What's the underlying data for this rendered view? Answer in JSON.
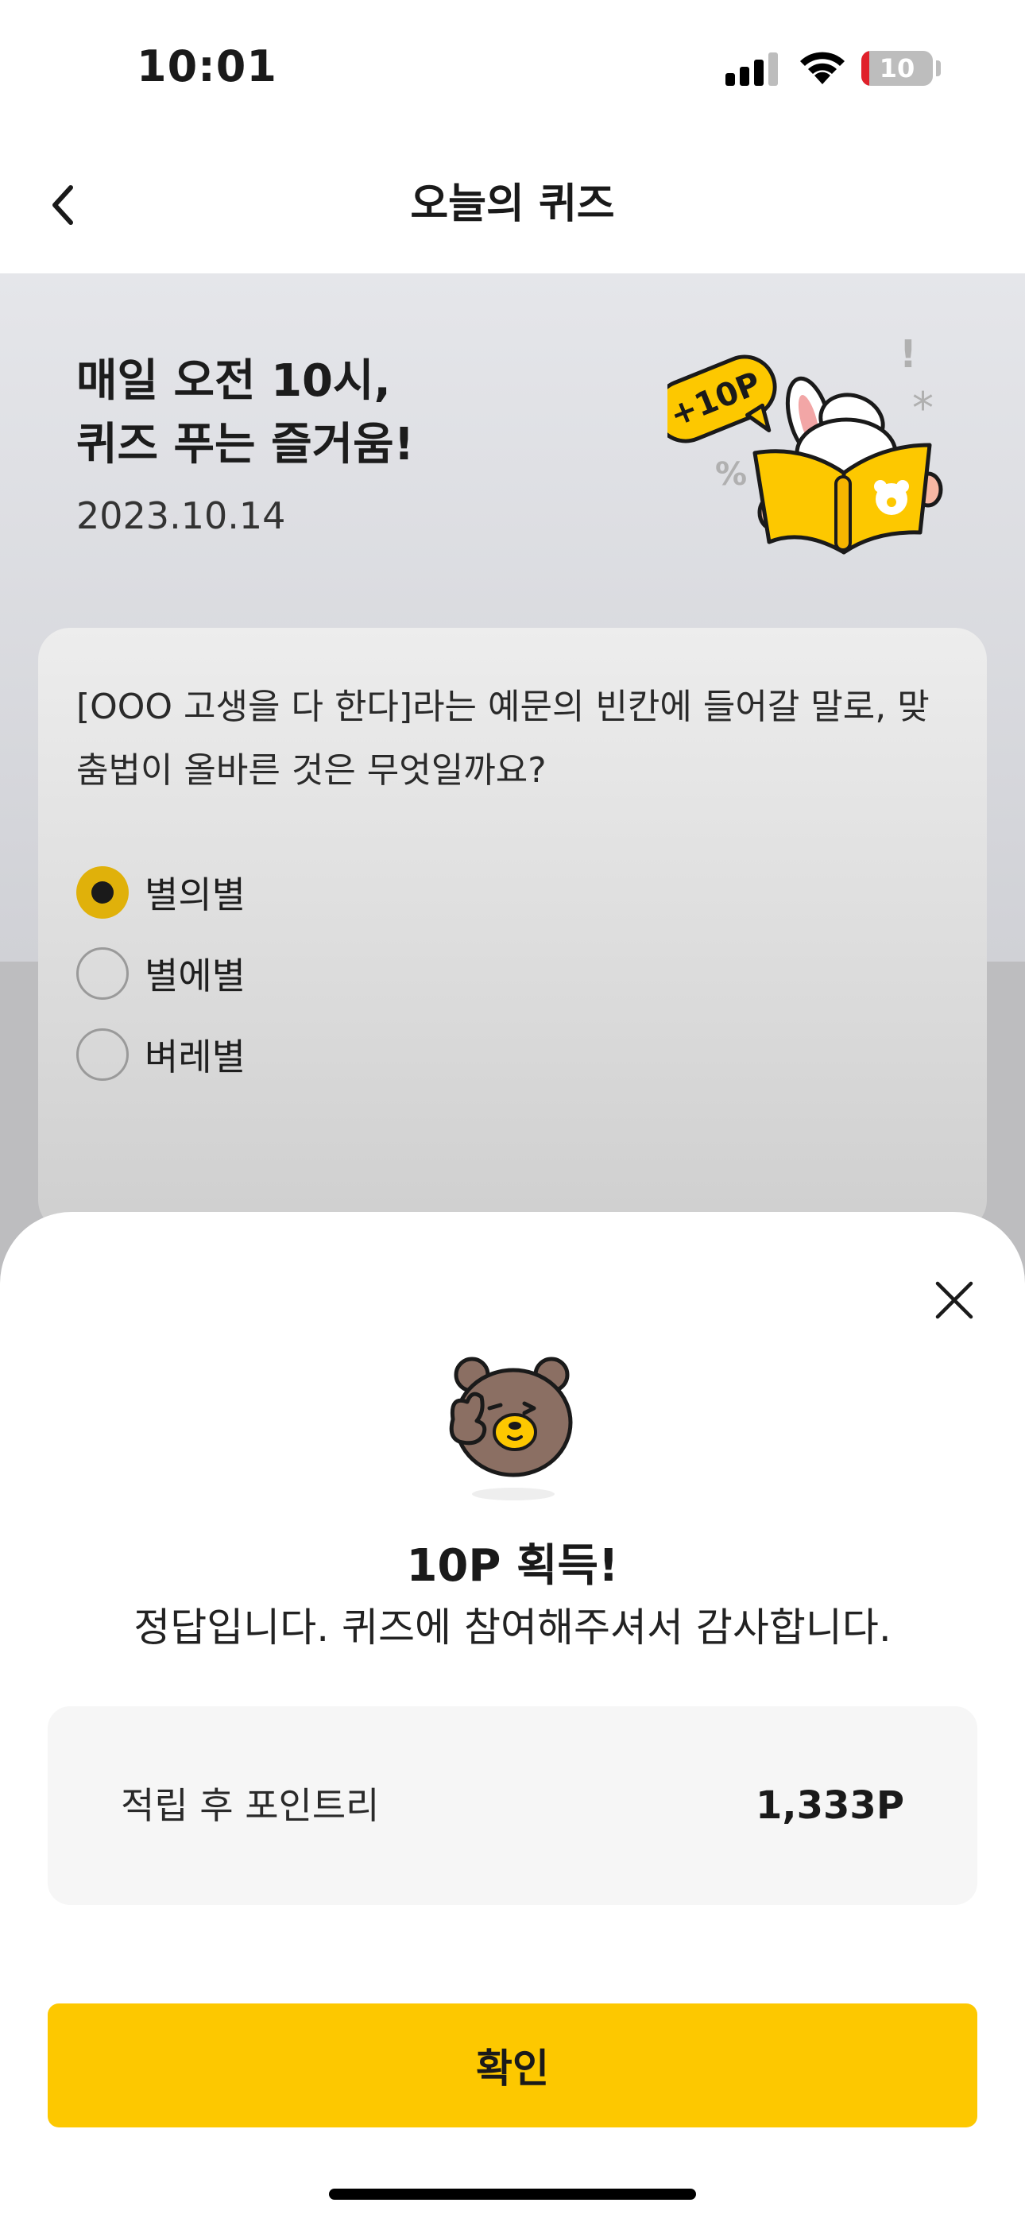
{
  "status_bar": {
    "time": "10:01",
    "battery": "10"
  },
  "nav": {
    "title": "오늘의 퀴즈",
    "back_icon": "chevron-left-icon"
  },
  "hero": {
    "title_line1": "매일 오전 10시,",
    "title_line2": "퀴즈 푸는 즐거움!",
    "date": "2023.10.14",
    "badge": "+10P"
  },
  "quiz": {
    "question": "[OOO 고생을 다 한다]라는 예문의 빈칸에 들어갈 말로, 맞춤법이 올바른 것은 무엇일까요?",
    "options": [
      {
        "label": "별의별",
        "selected": true
      },
      {
        "label": "별에별",
        "selected": false
      },
      {
        "label": "벼레별",
        "selected": false
      }
    ]
  },
  "result_sheet": {
    "title": "10P 획득!",
    "message": "정답입니다. 퀴즈에 참여해주셔서 감사합니다.",
    "points_label": "적립 후 포인트리",
    "points_value": "1,333P",
    "confirm_label": "확인"
  },
  "colors": {
    "accent": "#fdc800",
    "radio_selected": "#e0b10a",
    "battery_low": "#e0212b"
  }
}
